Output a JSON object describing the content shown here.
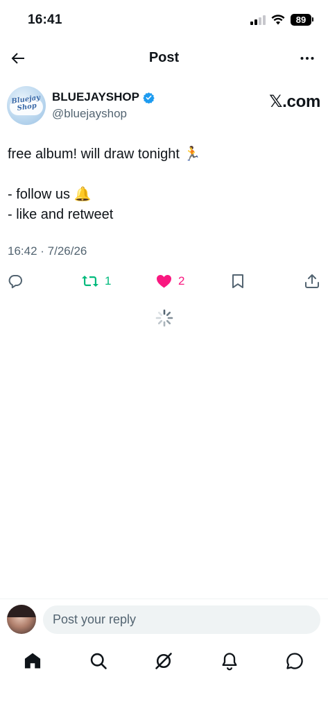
{
  "status_bar": {
    "time": "16:41",
    "battery": "89"
  },
  "header": {
    "title": "Post"
  },
  "post": {
    "author": {
      "display_name": "BLUEJAYSHOP",
      "handle": "@bluejayshop",
      "avatar_text": "Bluejay Shop"
    },
    "brand": "𝕏.com",
    "body_lines": [
      "free album! will draw tonight 🏃",
      "",
      "- follow us 🔔",
      "- like and retweet"
    ],
    "timestamp": "16:42 · 7/26/26",
    "stats": {
      "retweets": "1",
      "likes": "2"
    }
  },
  "reply": {
    "placeholder": "Post your reply"
  },
  "nav": {
    "items": [
      "home-icon",
      "search-icon",
      "grok-icon",
      "notifications-icon",
      "messages-icon"
    ]
  },
  "colors": {
    "text": "#0f1419",
    "muted": "#536471",
    "verified": "#1d9bf0",
    "retweet": "#00ba7c",
    "like": "#f91880",
    "input_bg": "#eff3f4"
  }
}
